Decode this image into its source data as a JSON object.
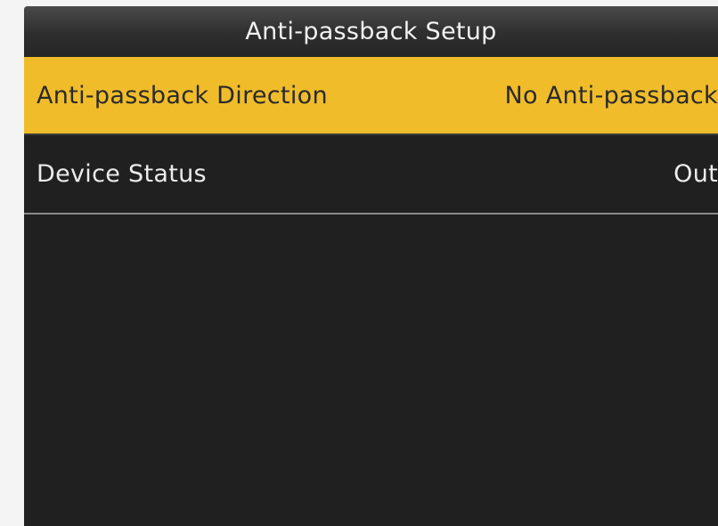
{
  "header": {
    "title": "Anti-passback Setup"
  },
  "menu": {
    "items": [
      {
        "label": "Anti-passback Direction",
        "value": "No Anti-passback",
        "selected": true
      },
      {
        "label": "Device Status",
        "value": "Out",
        "selected": false
      }
    ]
  },
  "colors": {
    "highlight": "#f0bc2a",
    "background": "#202020",
    "title_bar": "#2e2e2e"
  }
}
